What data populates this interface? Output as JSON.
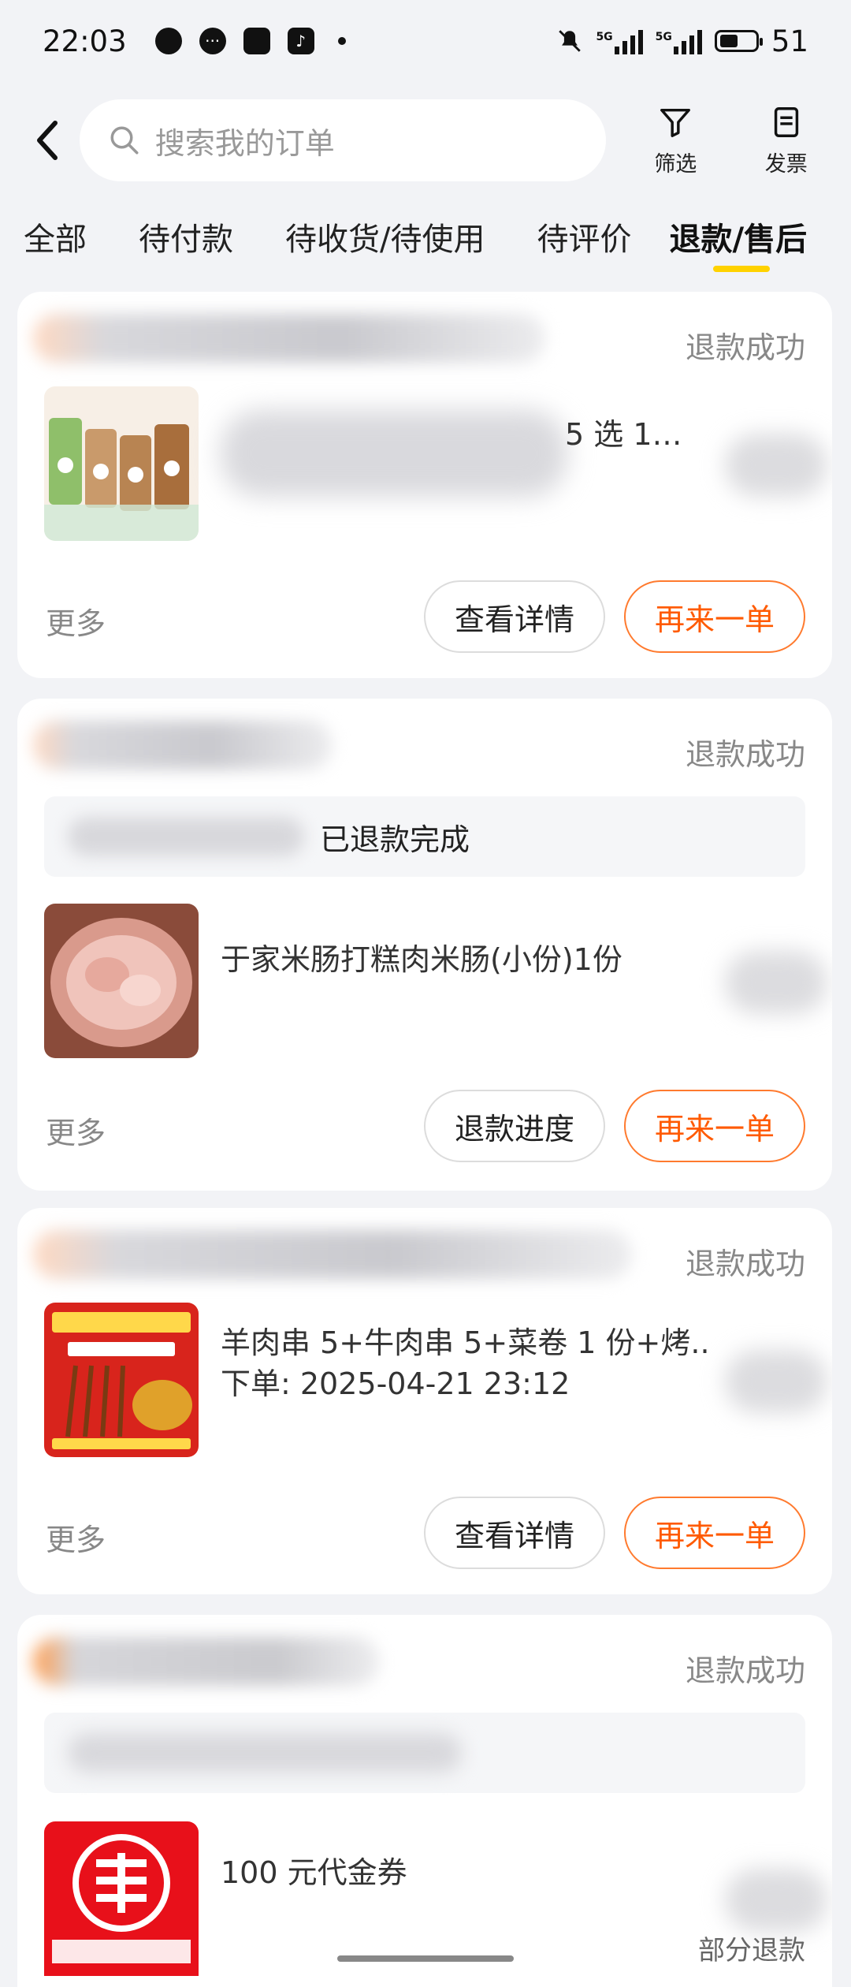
{
  "status_bar": {
    "time": "22:03",
    "battery": "51",
    "network_label_1": "5G",
    "network_label_2": "5G"
  },
  "header": {
    "search_placeholder": "搜索我的订单",
    "filter_label": "筛选",
    "invoice_label": "发票"
  },
  "tabs": [
    {
      "label": "全部",
      "active": false
    },
    {
      "label": "待付款",
      "active": false
    },
    {
      "label": "待收货/待使用",
      "active": false
    },
    {
      "label": "待评价",
      "active": false
    },
    {
      "label": "退款/售后",
      "active": true
    }
  ],
  "orders": [
    {
      "status": "退款成功",
      "title": "5 选 1…",
      "more": "更多",
      "buttons": [
        "查看详情",
        "再来一单"
      ]
    },
    {
      "status": "退款成功",
      "notice": "已退款完成",
      "title": "于家米肠打糕肉米肠(小份)1份",
      "more": "更多",
      "buttons": [
        "退款进度",
        "再来一单"
      ]
    },
    {
      "status": "退款成功",
      "title": "羊肉串 5+牛肉串 5+菜卷 1 份+烤..",
      "subtitle": "下单: 2025-04-21 23:12",
      "more": "更多",
      "buttons": [
        "查看详情",
        "再来一单"
      ]
    },
    {
      "status": "退款成功",
      "title": "100 元代金券",
      "tag": "部分退款"
    }
  ],
  "colors": {
    "accent": "#ff5a00",
    "tab_underline": "#ffd200",
    "background": "#f2f3f6"
  }
}
